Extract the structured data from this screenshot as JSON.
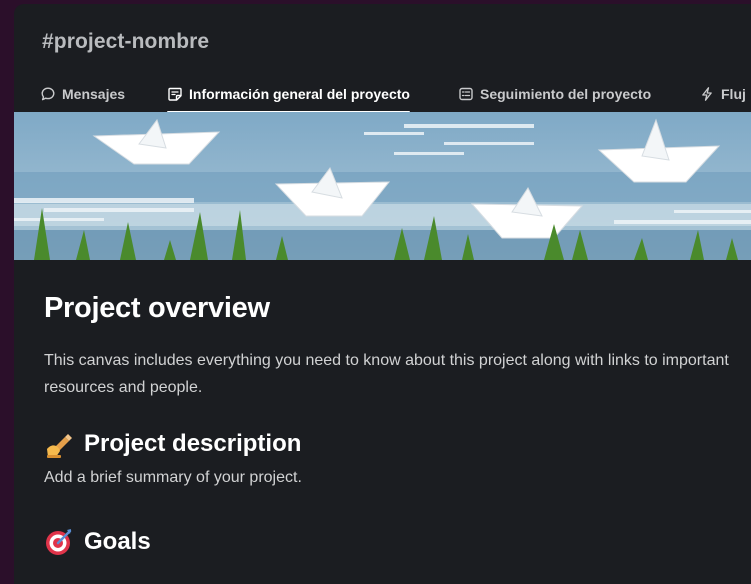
{
  "channel": {
    "name": "#project-nombre"
  },
  "tabs": [
    {
      "label": "Mensajes",
      "icon": "chat-bubble-icon",
      "active": false
    },
    {
      "label": "Información general del proyecto",
      "icon": "canvas-icon",
      "active": true
    },
    {
      "label": "Seguimiento del proyecto",
      "icon": "list-icon",
      "active": false
    },
    {
      "label": "Fluj",
      "icon": "lightning-icon",
      "active": false
    }
  ],
  "canvas": {
    "title": "Project overview",
    "intro": "This canvas includes everything you need to know about this project along with links to important resources and people.",
    "sections": [
      {
        "emoji": "writing-hand-icon",
        "heading": "Project description",
        "body": "Add a brief summary of your project."
      },
      {
        "emoji": "target-icon",
        "heading": "Goals",
        "body": ""
      }
    ]
  },
  "colors": {
    "background": "#1b1d21",
    "outer": "#2b0f2a",
    "text": "#d1d2d3",
    "heading": "#ffffff"
  }
}
